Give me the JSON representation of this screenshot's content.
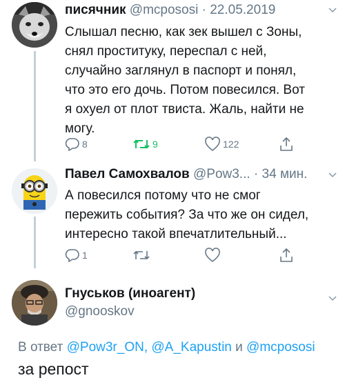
{
  "tweet1": {
    "name": "писячник",
    "handle": "@mcpososi",
    "sep": "·",
    "date": "22.05.2019",
    "text_lines": [
      "Слышал песню, как зек вышел с Зоны,",
      "снял проституку, переспал с ней,",
      "случайно заглянул в паспорт и понял,",
      "что это его дочь. Потом повесился. Вот",
      "я охуел от плот твиста. Жаль, найти не",
      "могу."
    ],
    "replies": "8",
    "retweets": "9",
    "likes": "122"
  },
  "tweet2": {
    "name": "Павел Самохвалов",
    "handle": "@Pow3...",
    "sep": "·",
    "time": "34 мин.",
    "text_lines": [
      "А повесился потому что не смог",
      "пережить события? За что же он сидел,",
      "интересно такой впечатлительный..."
    ],
    "replies": "1"
  },
  "tweet3": {
    "name": "Гнуськов (иноагент)",
    "handle": "@gnooskov",
    "reply_prefix": "В ответ",
    "mention1": "@Pow3r_ON,",
    "mention2": "@A_Kapustin",
    "conj": "и",
    "mention3": "@mcpososi",
    "text": "за репост"
  },
  "colors": {
    "text": "#14171a",
    "muted": "#657786",
    "link": "#1da1f2",
    "retweet_active": "#17bf63",
    "thread_line": "#c4cfd6"
  },
  "icons": [
    "reply-icon",
    "retweet-icon",
    "like-icon",
    "share-icon",
    "chevron-down-icon"
  ]
}
